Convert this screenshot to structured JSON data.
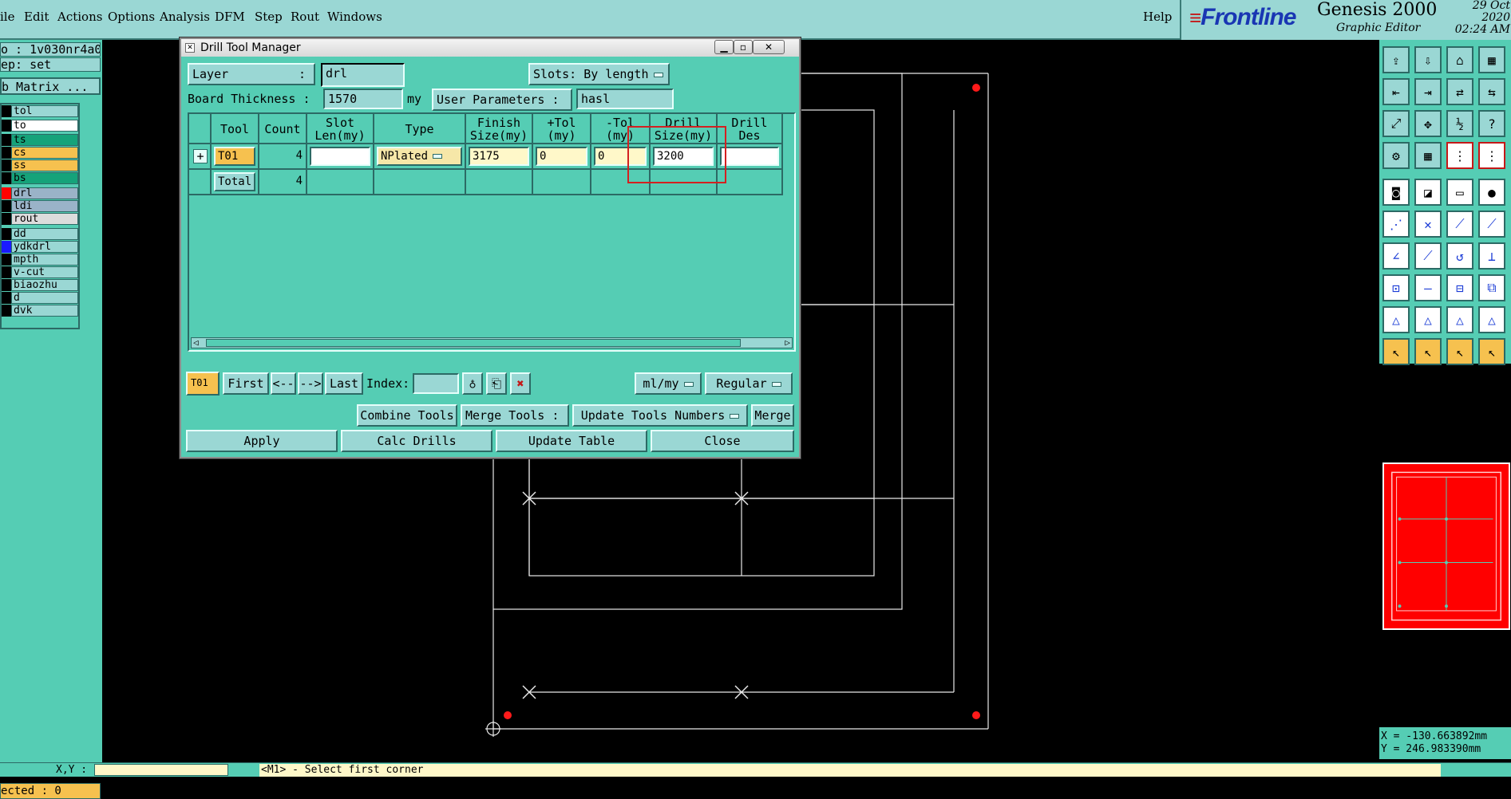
{
  "menubar": {
    "items": [
      "ile",
      "Edit",
      "Actions",
      "Options",
      "Analysis",
      "DFM",
      "Step",
      "Rout",
      "Windows"
    ],
    "help": "Help"
  },
  "brand": {
    "logo_lines": "≡",
    "logo": "Frontline",
    "product": "Genesis 2000",
    "subtitle": "Graphic Editor",
    "date": "29 Oct 2020",
    "time": "02:24 AM"
  },
  "left": {
    "job": "o : 1v030nr4a0",
    "step": "ep: set",
    "matrix_button": "b Matrix ...",
    "layers": [
      {
        "name": "tol",
        "color": "#9ad7d4",
        "mark": "#000"
      },
      {
        "name": "to",
        "color": "#ffffff",
        "mark": "#000"
      },
      {
        "name": "ts",
        "color": "#15a37a",
        "mark": "#000"
      },
      {
        "name": "cs",
        "color": "#f6c14f",
        "mark": "#000"
      },
      {
        "name": "ss",
        "color": "#f6c14f",
        "mark": "#000"
      },
      {
        "name": "bs",
        "color": "#15a37a",
        "mark": "#000"
      },
      {
        "name": "drl",
        "color": "#9ab3c8",
        "mark": "#ff0000"
      },
      {
        "name": "ldi",
        "color": "#9ab3c8",
        "mark": "#000"
      },
      {
        "name": "rout",
        "color": "#dcdcdc",
        "mark": "#000"
      },
      {
        "name": "dd",
        "color": "#9ad7d4",
        "mark": "#000"
      },
      {
        "name": "ydkdrl",
        "color": "#9ad7d4",
        "mark": "#1a1aff"
      },
      {
        "name": "mpth",
        "color": "#9ad7d4",
        "mark": "#000"
      },
      {
        "name": "v-cut",
        "color": "#9ad7d4",
        "mark": "#000"
      },
      {
        "name": "biaozhu",
        "color": "#9ad7d4",
        "mark": "#000"
      },
      {
        "name": "d",
        "color": "#9ad7d4",
        "mark": "#000"
      },
      {
        "name": "dvk",
        "color": "#9ad7d4",
        "mark": "#000"
      }
    ],
    "selected": "ected : 0"
  },
  "dialog": {
    "title": "Drill Tool Manager",
    "layer_label": "Layer",
    "layer_colon": ":",
    "layer_value": "drl",
    "slots_label": "Slots:",
    "slots_value": "By length",
    "thickness_label": "Board Thickness :",
    "thickness_value": "1570",
    "thickness_unit": "my",
    "user_params_label": "User Parameters :",
    "user_params_value": "hasl",
    "columns": [
      "",
      "Tool",
      "Count",
      "Slot\nLen(my)",
      "Type",
      "Finish\nSize(my)",
      "+Tol\n(my)",
      "-Tol\n(my)",
      "Drill\nSize(my)",
      "Drill\nDes"
    ],
    "rows": [
      {
        "expand": "+",
        "tool": "T01",
        "count": "4",
        "slot_len": "",
        "type": "NPlated",
        "finish": "3175",
        "ptol": "0",
        "ntol": "0",
        "drill": "3200",
        "des": ""
      }
    ],
    "total_label": "Total",
    "total_count": "4",
    "nav": {
      "current": "T01",
      "first": "First",
      "prev": "<--",
      "next": "-->",
      "last": "Last",
      "index_label": "Index:",
      "units": "ml/my",
      "mode": "Regular"
    },
    "combine_tools": "Combine Tools",
    "merge_tools_label": "Merge Tools :",
    "merge_option": "Update Tools Numbers",
    "merge_button": "Merge",
    "apply": "Apply",
    "calc_drills": "Calc Drills",
    "update_table": "Update Table",
    "close": "Close"
  },
  "coords": {
    "x": "X = -130.663892mm",
    "y": "Y = 246.983390mm"
  },
  "status": {
    "xy_label": "X,Y :",
    "message": "<M1> - Select first corner"
  }
}
